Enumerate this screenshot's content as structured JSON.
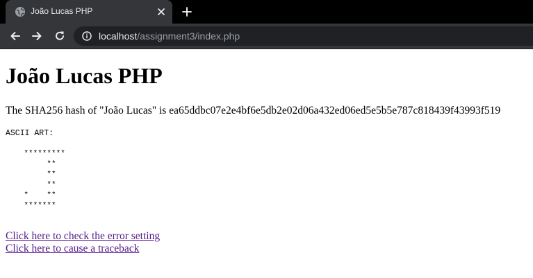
{
  "browser": {
    "tab": {
      "title": "João Lucas PHP"
    },
    "address_bar": {
      "host": "localhost",
      "path": "/assignment3/index.php"
    },
    "icons": {
      "favicon": "globe-icon",
      "tab_close": "close-icon",
      "new_tab": "plus-icon",
      "back": "back-arrow-icon",
      "forward": "forward-arrow-icon",
      "reload": "reload-icon",
      "site_info": "info-icon"
    },
    "colors": {
      "tabstrip": "#000000",
      "active_tab": "#35363a",
      "omnibox": "#202124",
      "text": "#e8eaed",
      "text_dim": "#9aa0a6"
    }
  },
  "page": {
    "title": "João Lucas PHP",
    "hash_line": "The SHA256 hash of \"João Lucas\" is ea65ddbc07e2e4bf6e5db2e02d06a432ed06ed5e5b5e787c818439f43993f519",
    "ascii_label": "ASCII ART:",
    "ascii_art": "    *********\n         **\n         **\n         **\n    *    **\n    *******",
    "links": [
      {
        "label": "Click here to check the error setting"
      },
      {
        "label": "Click here to cause a traceback"
      }
    ],
    "colors": {
      "link_visited": "#551a8b"
    }
  }
}
